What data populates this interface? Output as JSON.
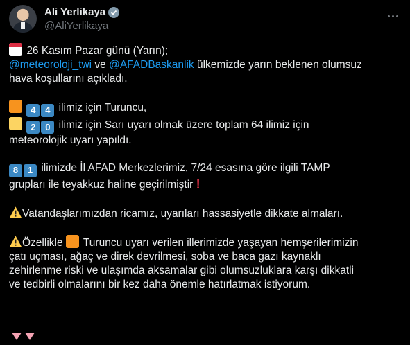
{
  "author": {
    "name": "Ali Yerlikaya",
    "handle": "@AliYerlikaya"
  },
  "tweet": {
    "line1": "26 Kasım Pazar günü (Yarın);",
    "mention1": "@meteoroloji_twi",
    "and": " ve ",
    "mention2": "@AFADBaskanlik",
    "line2_rest": " ülkemizde yarın beklenen olumsuz",
    "line3": "hava koşullarını açıkladı.",
    "orange_digits": [
      "4",
      "4"
    ],
    "orange_text": "ilimiz için Turuncu,",
    "yellow_digits": [
      "2",
      "0"
    ],
    "yellow_text": "ilimiz için Sarı uyarı olmak üzere toplam 64 ilimiz için",
    "yellow_text2": "meteorolojik uyarı yapıldı.",
    "afad_digits": [
      "8",
      "1"
    ],
    "afad_text": "ilimizde İl AFAD Merkezlerimiz, 7/24 esasına göre ilgili TAMP",
    "afad_text2": "grupları ile teyakkuz haline geçirilmiştir",
    "warn1": "Vatandaşlarımızdan ricamız, uyarıları hassasiyetle dikkate almaları.",
    "warn2_a": "Özellikle",
    "warn2_b": " Turuncu uyarı verilen illerimizde yaşayan hemşerilerimizin",
    "warn2_c": "çatı uçması, ağaç ve direk devrilmesi, soba ve baca gazı kaynaklı",
    "warn2_d": "zehirlenme riski ve ulaşımda aksamalar gibi olumsuzluklara karşı dikkatli",
    "warn2_e": "ve tedbirli olmalarını bir kez daha önemle hatırlatmak istiyorum."
  },
  "icons": [
    "calendar-icon",
    "orange-square-icon",
    "yellow-square-icon",
    "warning-icon",
    "red-exclamation-icon",
    "red-triangle-down-icon",
    "verified-badge-icon",
    "more-options-icon"
  ],
  "colors": {
    "background": "#000000",
    "text": "#e7e9ea",
    "link": "#1d9bf0",
    "secondary": "#71767b"
  }
}
